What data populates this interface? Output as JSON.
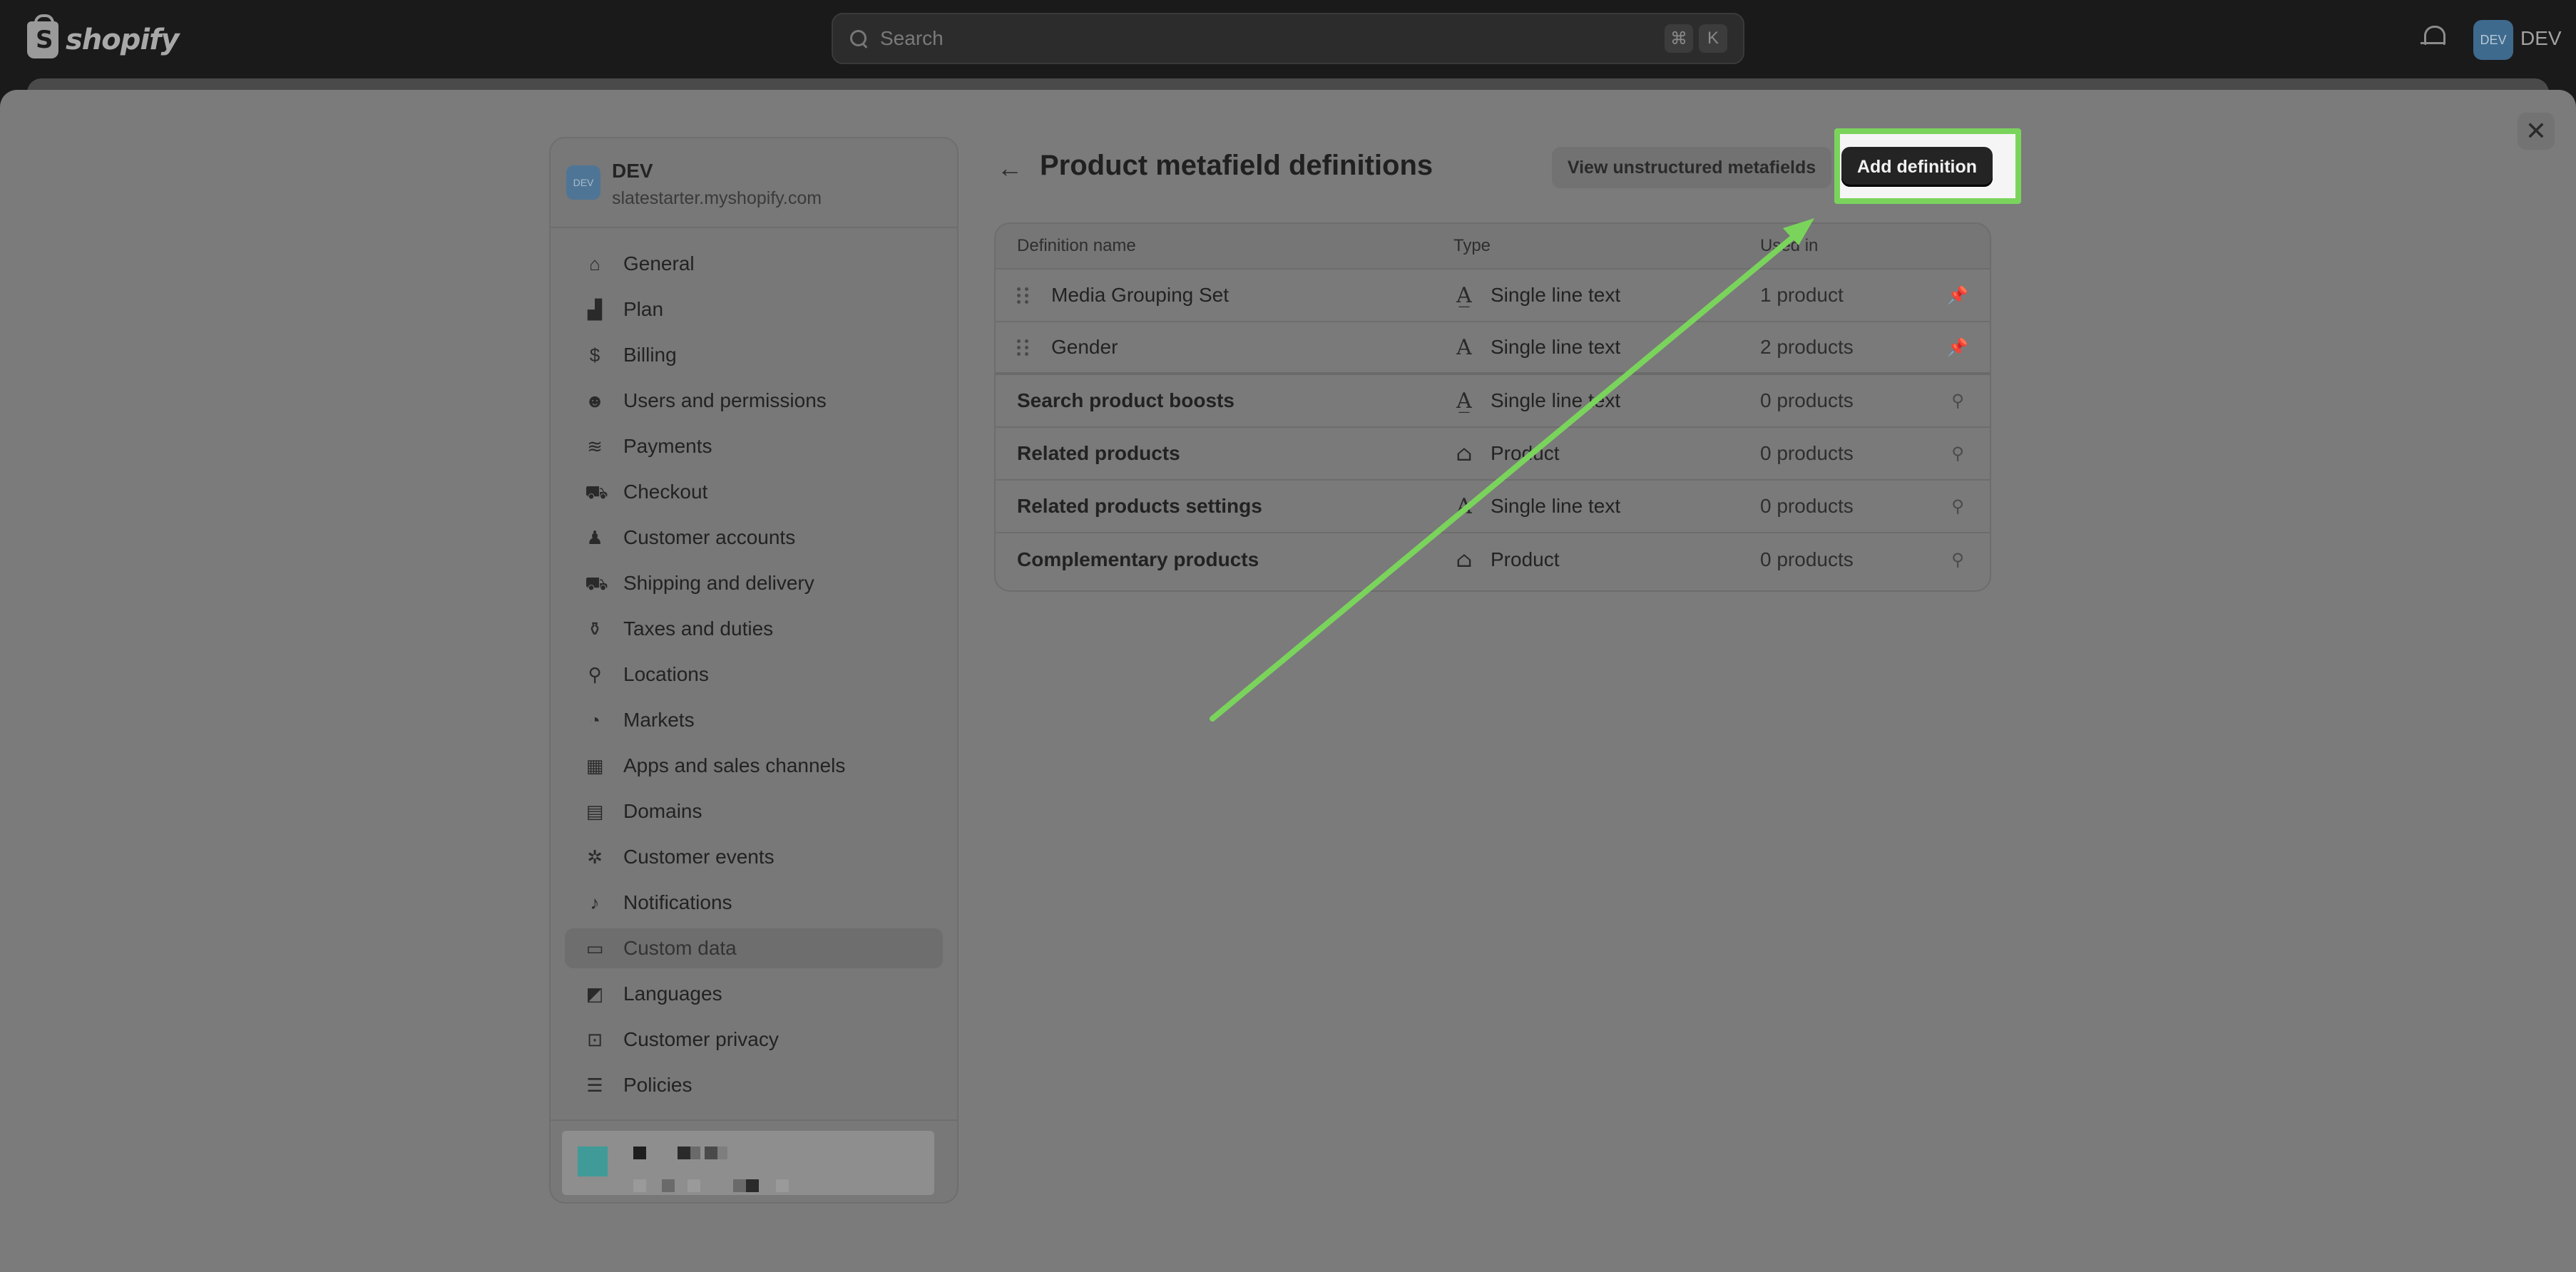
{
  "topbar": {
    "logo_text": "shopify",
    "search_placeholder": "Search",
    "shortcut_keys": [
      "⌘",
      "K"
    ],
    "avatar_initials": "DEV",
    "account_label": "DEV"
  },
  "modal": {
    "close_glyph": "✕"
  },
  "store": {
    "avatar_initials": "DEV",
    "name": "DEV",
    "url": "slatestarter.myshopify.com"
  },
  "sidebar": {
    "items": [
      {
        "label": "General",
        "icon": "store-icon",
        "glyph": "⌂",
        "active": false
      },
      {
        "label": "Plan",
        "icon": "plan-icon",
        "glyph": "▟",
        "active": false
      },
      {
        "label": "Billing",
        "icon": "billing-icon",
        "glyph": "$",
        "active": false
      },
      {
        "label": "Users and permissions",
        "icon": "users-icon",
        "glyph": "☻",
        "active": false
      },
      {
        "label": "Payments",
        "icon": "payments-icon",
        "glyph": "≋",
        "active": false
      },
      {
        "label": "Checkout",
        "icon": "cart-icon",
        "glyph": "⛟",
        "active": false
      },
      {
        "label": "Customer accounts",
        "icon": "person-icon",
        "glyph": "♟",
        "active": false
      },
      {
        "label": "Shipping and delivery",
        "icon": "truck-icon",
        "glyph": "⛟",
        "active": false
      },
      {
        "label": "Taxes and duties",
        "icon": "taxes-icon",
        "glyph": "⚱",
        "active": false
      },
      {
        "label": "Locations",
        "icon": "location-icon",
        "glyph": "⚲",
        "active": false
      },
      {
        "label": "Markets",
        "icon": "globe-icon",
        "glyph": "◔",
        "active": false
      },
      {
        "label": "Apps and sales channels",
        "icon": "apps-icon",
        "glyph": "▦",
        "active": false
      },
      {
        "label": "Domains",
        "icon": "domains-icon",
        "glyph": "▤",
        "active": false
      },
      {
        "label": "Customer events",
        "icon": "events-icon",
        "glyph": "✲",
        "active": false
      },
      {
        "label": "Notifications",
        "icon": "bell-icon",
        "glyph": "♪",
        "active": false
      },
      {
        "label": "Custom data",
        "icon": "custom-data-icon",
        "glyph": "▭",
        "active": true
      },
      {
        "label": "Languages",
        "icon": "languages-icon",
        "glyph": "◩",
        "active": false
      },
      {
        "label": "Customer privacy",
        "icon": "lock-icon",
        "glyph": "⊡",
        "active": false
      },
      {
        "label": "Policies",
        "icon": "policies-icon",
        "glyph": "☰",
        "active": false
      }
    ]
  },
  "page": {
    "back_glyph": "←",
    "title": "Product metafield definitions",
    "secondary_button": "View unstructured metafields",
    "primary_button": "Add definition"
  },
  "table": {
    "headers": {
      "name": "Definition name",
      "type": "Type",
      "used": "Used in"
    },
    "rows": [
      {
        "name": "Media Grouping Set",
        "type": "Single line text",
        "type_icon": "text-list-icon",
        "type_glyph": "A̲",
        "used": "1 product",
        "pinned": true,
        "draggable": true
      },
      {
        "name": "Gender",
        "type": "Single line text",
        "type_icon": "text-icon",
        "type_glyph": "A",
        "used": "2 products",
        "pinned": true,
        "draggable": true
      },
      {
        "name": "Search product boosts",
        "type": "Single line text",
        "type_icon": "text-list-icon",
        "type_glyph": "A̲",
        "used": "0 products",
        "pinned": false,
        "draggable": false
      },
      {
        "name": "Related products",
        "type": "Product",
        "type_icon": "product-tag-icon",
        "type_glyph": "⌂",
        "used": "0 products",
        "pinned": false,
        "draggable": false
      },
      {
        "name": "Related products settings",
        "type": "Single line text",
        "type_icon": "text-icon",
        "type_glyph": "A",
        "used": "0 products",
        "pinned": false,
        "draggable": false
      },
      {
        "name": "Complementary products",
        "type": "Product",
        "type_icon": "product-tag-icon",
        "type_glyph": "⌂",
        "used": "0 products",
        "pinned": false,
        "draggable": false
      }
    ]
  },
  "annotation": {
    "highlight_color": "#7ad45c",
    "arrow_color": "#7ad45c"
  }
}
